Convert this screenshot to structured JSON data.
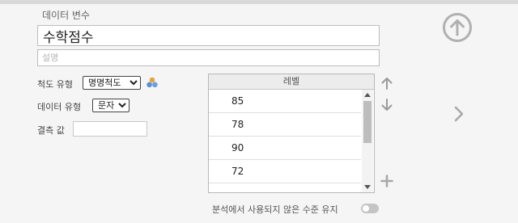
{
  "variable": {
    "section_title": "데이터 변수",
    "name_value": "수학점수",
    "description_placeholder": "설명"
  },
  "properties": {
    "measure_label": "척도 유형",
    "measure_value": "명명척도",
    "measure_options": [
      "명명척도"
    ],
    "datatype_label": "데이터 유형",
    "datatype_value": "문자",
    "datatype_options": [
      "문자"
    ],
    "missing_label": "결측 값",
    "missing_value": ""
  },
  "levels": {
    "header": "레벨",
    "items": [
      "85",
      "78",
      "90",
      "72"
    ]
  },
  "footer": {
    "retain_unused_label": "분석에서 사용되지 않은 수준 유지",
    "retain_unused_on": false
  },
  "icons": {
    "top_right": "circle-up-arrow-icon",
    "next": "chevron-right-icon",
    "measure_type": "nominal-measure-icon",
    "move_up": "arrow-up-icon",
    "move_down": "arrow-down-icon",
    "add": "plus-icon"
  },
  "colors": {
    "background": "#f5f5f5",
    "icon_gray": "#b0b0b0",
    "toggle_off": "#c4c4c4"
  }
}
